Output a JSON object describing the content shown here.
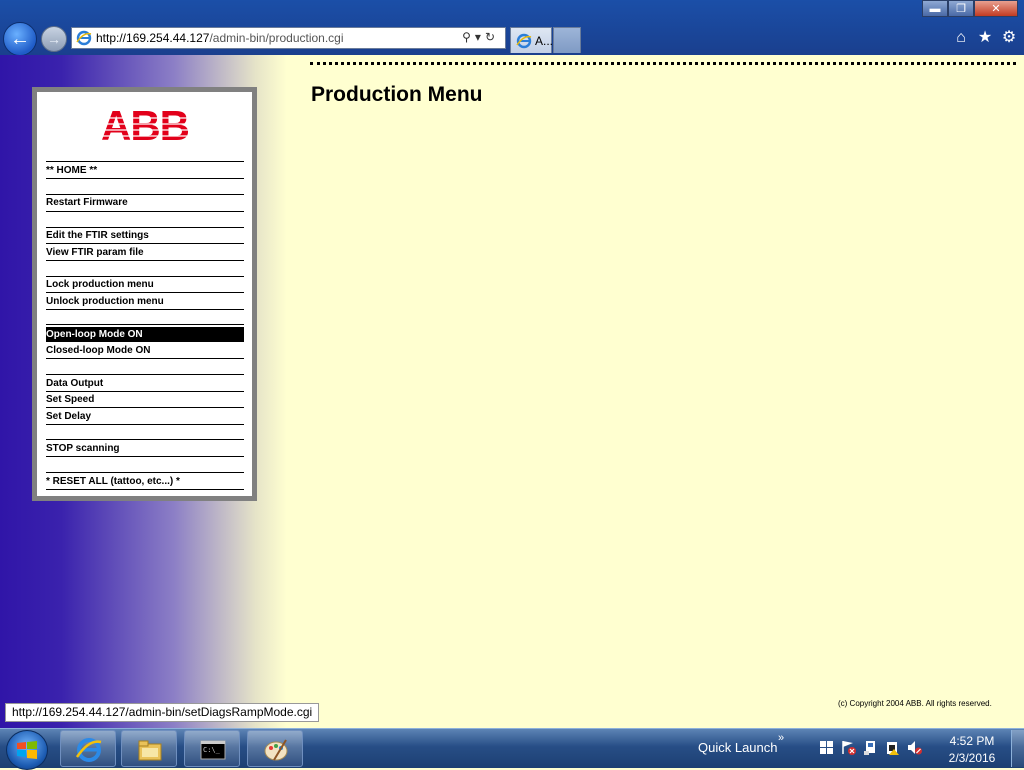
{
  "browser": {
    "address_host": "http://169.254.44.127",
    "address_path": "/admin-bin/production.cgi",
    "tab_label": "A...",
    "status_url": "http://169.254.44.127/admin-bin/setDiagsRampMode.cgi"
  },
  "logo": "ABB",
  "page": {
    "title": "Production Menu",
    "copyright": "(c) Copyright 2004 ABB. All rights reserved."
  },
  "menu": {
    "items": [
      {
        "label": "** HOME **"
      },
      {
        "label": "Restart Firmware"
      },
      {
        "label": "Edit the FTIR settings"
      },
      {
        "label": "View FTIR param file"
      },
      {
        "label": "Lock production menu"
      },
      {
        "label": "Unlock production menu"
      },
      {
        "label": "Open-loop Mode ON",
        "selected": true
      },
      {
        "label": "Closed-loop Mode ON"
      },
      {
        "label": "Data Output"
      },
      {
        "label": "Set Speed"
      },
      {
        "label": "Set Delay"
      },
      {
        "label": "STOP scanning"
      },
      {
        "label": "* RESET ALL (tattoo, etc...) *"
      }
    ]
  },
  "taskbar": {
    "quick_launch": "Quick Launch",
    "time": "4:52 PM",
    "date": "2/3/2016"
  },
  "colors": {
    "logo_red": "#e2001a",
    "page_bg": "#ffffd0",
    "gradient_blue": "#3015a8"
  }
}
